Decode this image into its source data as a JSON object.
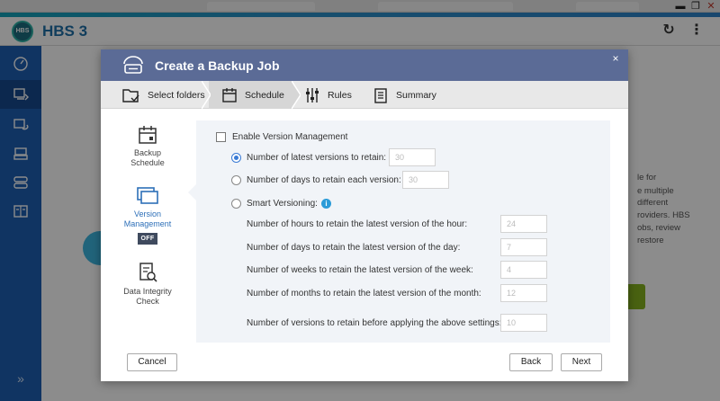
{
  "window": {
    "minimize": "▬",
    "maximize": "❐",
    "close": "✕"
  },
  "app": {
    "logo_text": "HBS",
    "title": "HBS 3"
  },
  "sidebar": {
    "items": [
      {
        "icon": "dashboard-icon"
      },
      {
        "icon": "backup-icon"
      },
      {
        "icon": "sync-icon"
      },
      {
        "icon": "restore-icon"
      },
      {
        "icon": "storage-icon"
      },
      {
        "icon": "logs-icon"
      }
    ],
    "expand_label": "»"
  },
  "background": {
    "lines": [
      "le for",
      "e multiple",
      "different",
      "roviders. HBS",
      "obs, review",
      "restore"
    ]
  },
  "dialog": {
    "title": "Create a Backup Job",
    "close": "×",
    "steps": [
      {
        "label": "Select folders",
        "icon": "select-folders-icon"
      },
      {
        "label": "Schedule",
        "icon": "calendar-icon"
      },
      {
        "label": "Rules",
        "icon": "sliders-icon"
      },
      {
        "label": "Summary",
        "icon": "clipboard-icon"
      }
    ],
    "nav": [
      {
        "label_line1": "Backup",
        "label_line2": "Schedule",
        "icon": "calendar-icon"
      },
      {
        "label_line1": "Version",
        "label_line2": "Management",
        "badge": "OFF",
        "icon": "versions-icon"
      },
      {
        "label_line1": "Data Integrity",
        "label_line2": "Check",
        "icon": "integrity-check-icon"
      }
    ],
    "version_management": {
      "enable_label": "Enable Version Management",
      "latest_versions_label": "Number of latest versions to retain:",
      "latest_versions_value": "30",
      "days_label": "Number of days to retain each version:",
      "days_value": "30",
      "smart_label": "Smart Versioning:",
      "hours_label": "Number of hours to retain the latest version of the hour:",
      "hours_value": "24",
      "day_label": "Number of days to retain the latest version of the day:",
      "day_value": "7",
      "weeks_label": "Number of weeks to retain the latest version of the week:",
      "weeks_value": "4",
      "months_label": "Number of months to retain the latest version of the month:",
      "months_value": "12",
      "before_label": "Number of versions to retain before applying the above settings:",
      "before_value": "10"
    },
    "buttons": {
      "cancel": "Cancel",
      "back": "Back",
      "next": "Next"
    }
  },
  "colors": {
    "sidebar": "#1e5fb3",
    "dialog_header": "#5b6b96",
    "accent_blue": "#3a7bd5",
    "panel_bg": "#f1f4f8"
  }
}
